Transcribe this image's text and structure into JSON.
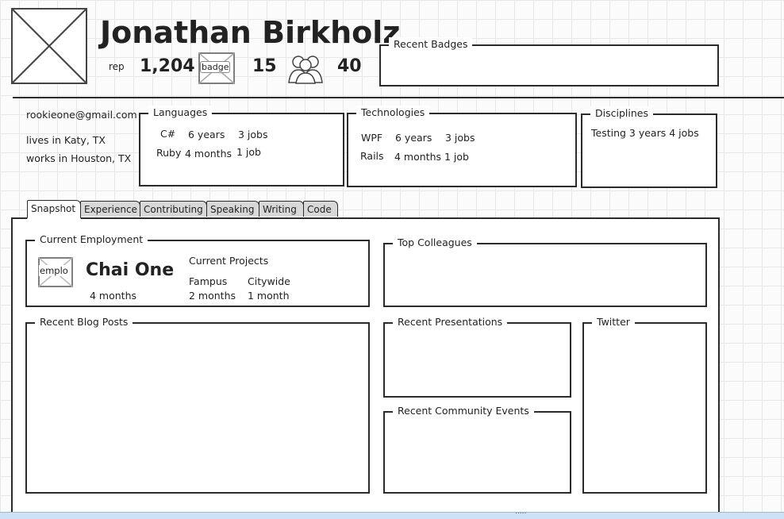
{
  "profile": {
    "name": "Jonathan Birkholz",
    "rep_label": "rep",
    "rep_value": "1,204",
    "badge_label": "badge",
    "badge_count": "15",
    "people_count": "40"
  },
  "recent_badges": {
    "title": "Recent Badges"
  },
  "contact": {
    "email": "rookieone@gmail.com",
    "lives": "lives in Katy, TX",
    "works": "works in Houston, TX"
  },
  "languages": {
    "title": "Languages",
    "rows": [
      {
        "name": "C#",
        "duration": "6 years",
        "jobs": "3 jobs"
      },
      {
        "name": "Ruby",
        "duration": "4 months",
        "jobs": "1 job"
      }
    ]
  },
  "technologies": {
    "title": "Technologies",
    "rows": [
      {
        "name": "WPF",
        "duration": "6 years",
        "jobs": "3 jobs"
      },
      {
        "name": "Rails",
        "duration": "4 months",
        "jobs": "1 job"
      }
    ]
  },
  "disciplines": {
    "title": "Disciplines",
    "rows": [
      {
        "text": "Testing 3 years 4 jobs"
      }
    ]
  },
  "tabs": [
    {
      "label": "Snapshot",
      "active": true
    },
    {
      "label": "Experience",
      "active": false
    },
    {
      "label": "Contributing",
      "active": false
    },
    {
      "label": "Speaking",
      "active": false
    },
    {
      "label": "Writing",
      "active": false
    },
    {
      "label": "Code",
      "active": false
    }
  ],
  "employment": {
    "title": "Current Employment",
    "logo_label": "emplo",
    "company": "Chai One",
    "tenure": "4 months",
    "projects_title": "Current Projects",
    "projects": [
      {
        "name": "Fampus",
        "duration": "2 months"
      },
      {
        "name": "Citywide",
        "duration": "1 month"
      }
    ]
  },
  "sections": {
    "top_colleagues": "Top Colleagues",
    "recent_blog_posts": "Recent Blog Posts",
    "recent_presentations": "Recent Presentations",
    "twitter": "Twitter",
    "recent_community_events": "Recent Community Events"
  },
  "footer": {
    "grip": "....."
  }
}
